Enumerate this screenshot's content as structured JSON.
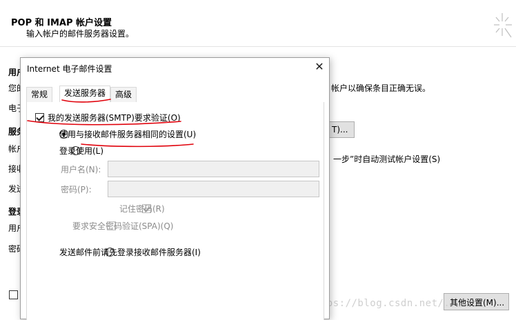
{
  "background_window": {
    "title": "POP 和 IMAP 帐户设置",
    "subtitle": "输入帐户的邮件服务器设置。",
    "fragments": {
      "user_info_heading": "用户",
      "user_text": "您的",
      "email_label": "电子",
      "server_heading": "服务",
      "account_type_label": "帐户",
      "incoming_label": "接收",
      "outgoing_label": "发送",
      "login_heading": "登录",
      "username_label": "用户",
      "password_label": "密码",
      "test_text": "帐户以确保条目正确无误。",
      "test_button": "T)...",
      "auto_test_text": "一步”时自动测试帐户设置(S)",
      "more_settings_button": "其他设置(M)..."
    },
    "watermark": "https://blog.csdn.net/..."
  },
  "dialog": {
    "title": "Internet 电子邮件设置",
    "close_label": "✕",
    "tabs": [
      {
        "label": "常规",
        "active": false
      },
      {
        "label": "发送服务器",
        "active": true
      },
      {
        "label": "高级",
        "active": false
      }
    ],
    "smtp_auth": {
      "label": "我的发送服务器(SMTP)要求验证(O)",
      "checked": true
    },
    "radio_same": {
      "label": "使用与接收邮件服务器相同的设置(U)",
      "checked": true
    },
    "radio_login": {
      "label": "登录使用(L)",
      "checked": false
    },
    "username_label": "用户名(N):",
    "username_value": "",
    "password_label": "密码(P):",
    "password_value": "",
    "remember_password": {
      "label": "记住密码(R)",
      "checked": true
    },
    "spa": {
      "label": "要求安全密码验证(SPA)(Q)",
      "checked": false
    },
    "radio_pop_before": {
      "label": "发送邮件前请先登录接收邮件服务器(I)",
      "checked": false
    }
  },
  "annotation_color": "#e0000a"
}
